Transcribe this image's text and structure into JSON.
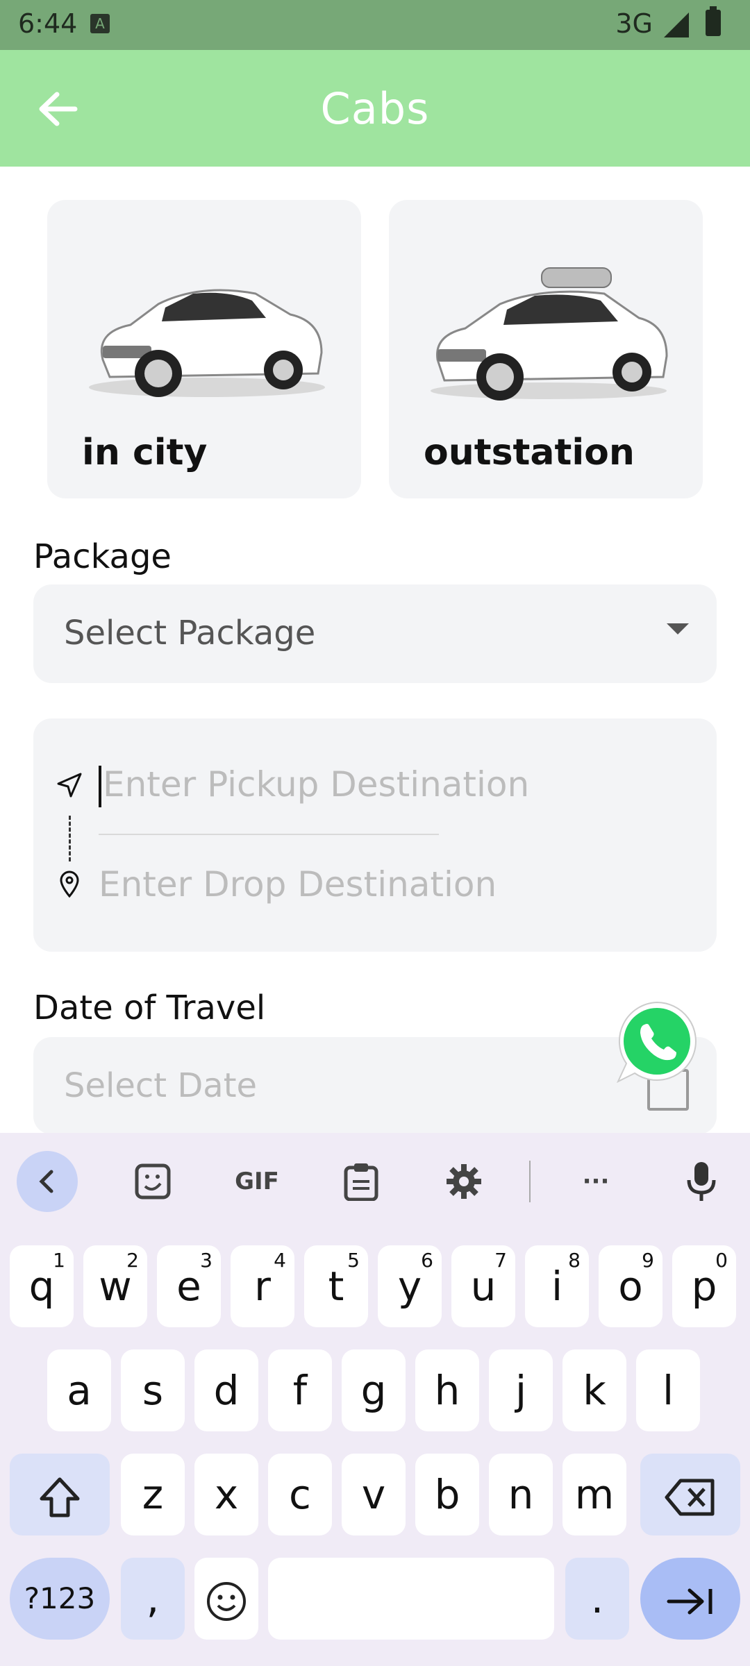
{
  "status_bar": {
    "time": "6:44",
    "notification_icon": "A",
    "network": "3G"
  },
  "app_bar": {
    "title": "Cabs",
    "back_icon": "arrow-left-icon"
  },
  "cab_types": [
    {
      "label": "in city",
      "icon": "sedan-car-image"
    },
    {
      "label": "outstation",
      "icon": "car-with-roof-box-image"
    }
  ],
  "package": {
    "label": "Package",
    "placeholder": "Select Package"
  },
  "route": {
    "pickup_placeholder": "Enter Pickup Destination",
    "drop_placeholder": "Enter Drop Destination"
  },
  "date": {
    "label": "Date of Travel",
    "placeholder": "Select Date"
  },
  "colors": {
    "app_bar": "#9fe49f",
    "status_bar": "#77a877",
    "card_bg": "#f3f4f6",
    "keyboard_bg": "#f0ebf6",
    "whatsapp": "#25d366"
  },
  "keyboard": {
    "toolbar": [
      "back",
      "sticker",
      "GIF",
      "clipboard",
      "settings",
      "more",
      "mic"
    ],
    "gif_label": "GIF",
    "more_label": "···",
    "row1": [
      {
        "k": "q",
        "n": "1"
      },
      {
        "k": "w",
        "n": "2"
      },
      {
        "k": "e",
        "n": "3"
      },
      {
        "k": "r",
        "n": "4"
      },
      {
        "k": "t",
        "n": "5"
      },
      {
        "k": "y",
        "n": "6"
      },
      {
        "k": "u",
        "n": "7"
      },
      {
        "k": "i",
        "n": "8"
      },
      {
        "k": "o",
        "n": "9"
      },
      {
        "k": "p",
        "n": "0"
      }
    ],
    "row2": [
      "a",
      "s",
      "d",
      "f",
      "g",
      "h",
      "j",
      "k",
      "l"
    ],
    "row3": [
      "z",
      "x",
      "c",
      "v",
      "b",
      "n",
      "m"
    ],
    "sym_label": "?123",
    "comma": ",",
    "period": "."
  }
}
